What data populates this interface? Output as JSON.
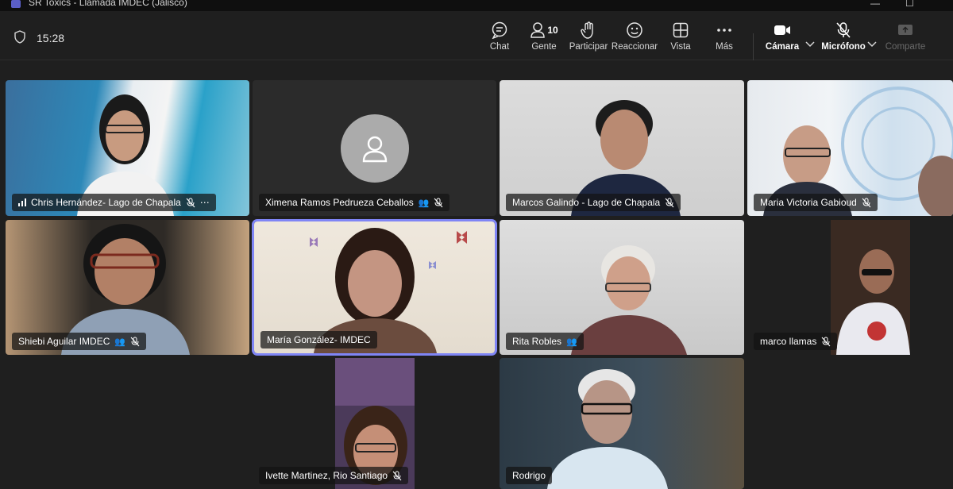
{
  "window": {
    "title": "SR Toxics - Llamada IMDEC (Jalisco)",
    "minimize": "—",
    "maximize": "☐"
  },
  "meeting": {
    "time": "15:28"
  },
  "toolbar": {
    "chat": "Chat",
    "people": "Gente",
    "people_count": "10",
    "raise_hand": "Participar",
    "react": "Reaccionar",
    "view": "Vista",
    "more": "Más",
    "camera": "Cámara",
    "mic": "Micrófono",
    "share": "Comparte"
  },
  "participants": [
    {
      "name": "Chris Hernández- Lago de Chapala",
      "muted": true,
      "video": true
    },
    {
      "name": "Ximena Ramos Pedrueza Ceballos",
      "muted": true,
      "video": false
    },
    {
      "name": "Marcos Galindo - Lago de Chapala",
      "muted": true,
      "video": true
    },
    {
      "name": "Maria Victoria Gabioud",
      "muted": true,
      "video": true
    },
    {
      "name": "Shiebi Aguilar IMDEC",
      "muted": true,
      "video": true
    },
    {
      "name": "María González- IMDEC",
      "muted": false,
      "video": true,
      "speaking": true
    },
    {
      "name": "Rita Robles",
      "muted": false,
      "video": true
    },
    {
      "name": "marco llamas",
      "muted": true,
      "video": true
    },
    {
      "name": "Ivette Martinez, Rio Santiago",
      "muted": true,
      "video": true
    },
    {
      "name": "Rodrigo",
      "muted": false,
      "video": true
    }
  ],
  "colors": {
    "accent": "#7f85f5",
    "background": "#1f1f1f",
    "tile_dark": "#2b2b2b"
  }
}
